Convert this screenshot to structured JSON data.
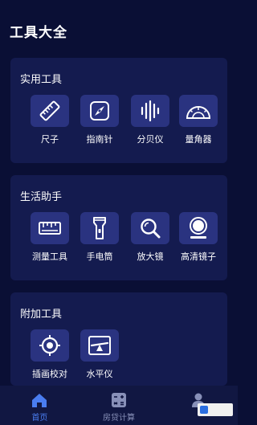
{
  "app": {
    "title": "工具大全"
  },
  "sections": [
    {
      "title": "实用工具",
      "tools": [
        {
          "label": "尺子",
          "icon": "ruler-icon"
        },
        {
          "label": "指南针",
          "icon": "compass-icon"
        },
        {
          "label": "分贝仪",
          "icon": "sound-wave-icon"
        },
        {
          "label": "量角器",
          "icon": "protractor-icon"
        }
      ]
    },
    {
      "title": "生活助手",
      "tools": [
        {
          "label": "测量工具",
          "icon": "measure-tape-icon"
        },
        {
          "label": "手电筒",
          "icon": "flashlight-icon"
        },
        {
          "label": "放大镜",
          "icon": "magnifier-icon"
        },
        {
          "label": "高清镜子",
          "icon": "mirror-icon"
        }
      ]
    },
    {
      "title": "附加工具",
      "tools": [
        {
          "label": "插画校对",
          "icon": "crosshair-icon"
        },
        {
          "label": "水平仪",
          "icon": "level-icon"
        }
      ]
    }
  ],
  "tabbar": {
    "tabs": [
      {
        "label": "首页",
        "icon": "home-icon",
        "active": true
      },
      {
        "label": "房贷计算",
        "icon": "calculator-icon",
        "active": false
      },
      {
        "label": "",
        "icon": "user-icon",
        "active": false
      }
    ]
  },
  "colors": {
    "background": "#0a0f35",
    "card": "#141b4f",
    "icon_bg": "#2a3380",
    "accent": "#4a7df0"
  }
}
